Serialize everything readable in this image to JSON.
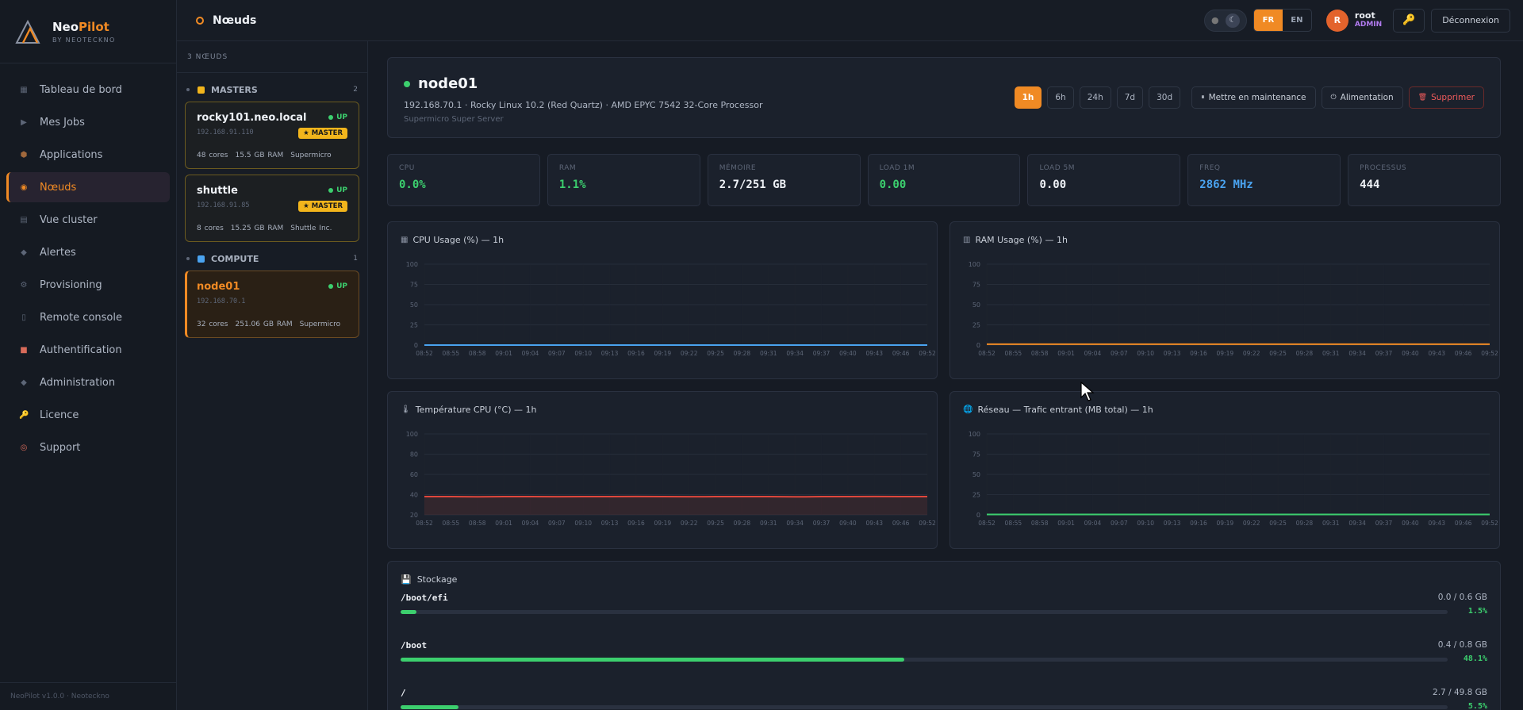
{
  "brand": {
    "name_a": "Neo",
    "name_b": "Pilot",
    "sub": "BY NEOTECKNO"
  },
  "sidebar": {
    "items": [
      {
        "label": "Tableau de bord",
        "icon": "grid-icon",
        "glyph": "▦"
      },
      {
        "label": "Mes Jobs",
        "icon": "play-icon",
        "glyph": "▶"
      },
      {
        "label": "Applications",
        "icon": "box-icon",
        "glyph": "⬢"
      },
      {
        "label": "Nœuds",
        "icon": "node-icon",
        "glyph": "◉"
      },
      {
        "label": "Vue cluster",
        "icon": "cluster-icon",
        "glyph": "▤"
      },
      {
        "label": "Alertes",
        "icon": "alert-icon",
        "glyph": "◆"
      },
      {
        "label": "Provisioning",
        "icon": "gear-icon",
        "glyph": "⚙"
      },
      {
        "label": "Remote console",
        "icon": "terminal-icon",
        "glyph": "▯"
      },
      {
        "label": "Authentification",
        "icon": "lock-icon",
        "glyph": "■"
      },
      {
        "label": "Administration",
        "icon": "admin-icon",
        "glyph": "◆"
      },
      {
        "label": "Licence",
        "icon": "key-icon",
        "glyph": "🔑"
      },
      {
        "label": "Support",
        "icon": "lifebuoy-icon",
        "glyph": "◎"
      }
    ],
    "footer": "NeoPilot v1.0.0 · Neoteckno"
  },
  "topbar": {
    "title": "Nœuds",
    "lang_fr": "FR",
    "lang_en": "EN",
    "user_initial": "R",
    "user_name": "root",
    "user_role": "ADMIN",
    "logout": "Déconnexion"
  },
  "nodelist": {
    "count": "3 NŒUDS",
    "groups": [
      {
        "name": "MASTERS",
        "count": "2",
        "color": "#f2b51c"
      },
      {
        "name": "COMPUTE",
        "count": "1",
        "color": "#4aa3f0"
      }
    ],
    "nodes": [
      {
        "name": "rocky101.neo.local",
        "ip": "192.168.91.110",
        "cores": "48 cores",
        "ram": "15.5 GB RAM",
        "vendor": "Supermicro",
        "status": "UP",
        "badge": "★ MASTER"
      },
      {
        "name": "shuttle",
        "ip": "192.168.91.85",
        "cores": "8 cores",
        "ram": "15.25 GB RAM",
        "vendor": "Shuttle Inc.",
        "status": "UP",
        "badge": "★ MASTER"
      },
      {
        "name": "node01",
        "ip": "192.168.70.1",
        "cores": "32 cores",
        "ram": "251.06 GB RAM",
        "vendor": "Supermicro",
        "status": "UP"
      }
    ]
  },
  "node": {
    "name": "node01",
    "info": "192.168.70.1 · Rocky Linux 10.2 (Red Quartz) · AMD EPYC 7542 32-Core Processor",
    "hardware": "Supermicro Super Server",
    "ranges": [
      "1h",
      "6h",
      "24h",
      "7d",
      "30d"
    ],
    "actions": {
      "maintenance": "Mettre en maintenance",
      "power": "Alimentation",
      "delete": "Supprimer"
    }
  },
  "stats": [
    {
      "label": "CPU",
      "value": "0.0%",
      "tone": "green"
    },
    {
      "label": "RAM",
      "value": "1.1%",
      "tone": "green"
    },
    {
      "label": "MÉMOIRE",
      "value": "2.7/251 GB",
      "tone": "white"
    },
    {
      "label": "LOAD 1M",
      "value": "0.00",
      "tone": "green"
    },
    {
      "label": "LOAD 5M",
      "value": "0.00",
      "tone": "white"
    },
    {
      "label": "FREQ",
      "value": "2862 MHz",
      "tone": "blue"
    },
    {
      "label": "PROCESSUS",
      "value": "444",
      "tone": "white"
    }
  ],
  "chart_data": [
    {
      "type": "line",
      "title": "CPU Usage (%) — 1h",
      "icon": "chip-icon",
      "color": "#4aa3f0",
      "ylim": [
        0,
        100
      ],
      "yticks": [
        0,
        25,
        50,
        75,
        100
      ],
      "x": [
        "08:52",
        "08:55",
        "08:58",
        "09:01",
        "09:04",
        "09:07",
        "09:10",
        "09:13",
        "09:16",
        "09:19",
        "09:22",
        "09:25",
        "09:28",
        "09:31",
        "09:34",
        "09:37",
        "09:40",
        "09:43",
        "09:46",
        "09:52"
      ],
      "values": [
        0,
        0,
        0,
        0,
        0,
        0,
        0,
        0,
        0,
        0,
        0,
        0,
        0,
        0,
        0,
        0,
        0,
        0,
        0,
        0
      ]
    },
    {
      "type": "line",
      "title": "RAM Usage (%) — 1h",
      "icon": "memory-icon",
      "color": "#f08a24",
      "ylim": [
        0,
        100
      ],
      "yticks": [
        0,
        25,
        50,
        75,
        100
      ],
      "x": [
        "08:52",
        "08:55",
        "08:58",
        "09:01",
        "09:04",
        "09:07",
        "09:10",
        "09:13",
        "09:16",
        "09:19",
        "09:22",
        "09:25",
        "09:28",
        "09:31",
        "09:34",
        "09:37",
        "09:40",
        "09:43",
        "09:46",
        "09:52"
      ],
      "values": [
        1.1,
        1.1,
        1.1,
        1.1,
        1.1,
        1.1,
        1.1,
        1.1,
        1.1,
        1.1,
        1.1,
        1.1,
        1.1,
        1.1,
        1.1,
        1.1,
        1.1,
        1.1,
        1.1,
        1.1
      ]
    },
    {
      "type": "area",
      "title": "Température CPU (°C) — 1h",
      "icon": "thermometer-icon",
      "color": "#e0473c",
      "ylim": [
        20,
        100
      ],
      "yticks": [
        20,
        40,
        60,
        80,
        100
      ],
      "x": [
        "08:52",
        "08:55",
        "08:58",
        "09:01",
        "09:04",
        "09:07",
        "09:10",
        "09:13",
        "09:16",
        "09:19",
        "09:22",
        "09:25",
        "09:28",
        "09:31",
        "09:34",
        "09:37",
        "09:40",
        "09:43",
        "09:46",
        "09:52"
      ],
      "values": [
        38,
        38,
        37.8,
        38,
        38,
        37.9,
        38,
        38,
        38.1,
        38,
        37.9,
        38,
        38,
        38,
        37.8,
        38,
        38,
        38.1,
        38,
        38
      ]
    },
    {
      "type": "line",
      "title": "Réseau — Trafic entrant (MB total) — 1h",
      "icon": "globe-icon",
      "color": "#3ccf6e",
      "ylim": [
        0,
        100
      ],
      "yticks": [
        0,
        25,
        50,
        75,
        100
      ],
      "x": [
        "08:52",
        "08:55",
        "08:58",
        "09:01",
        "09:04",
        "09:07",
        "09:10",
        "09:13",
        "09:16",
        "09:19",
        "09:22",
        "09:25",
        "09:28",
        "09:31",
        "09:34",
        "09:37",
        "09:40",
        "09:43",
        "09:46",
        "09:52"
      ],
      "values": [
        0.5,
        0.5,
        0.5,
        0.5,
        0.5,
        0.5,
        0.5,
        0.5,
        0.5,
        0.5,
        0.5,
        0.5,
        0.5,
        0.5,
        0.5,
        0.5,
        0.5,
        0.5,
        0.5,
        0.5
      ]
    }
  ],
  "storage": {
    "title": "Stockage",
    "disks": [
      {
        "mount": "/boot/efi",
        "used": "0.0 / 0.6 GB",
        "pct": "1.5%",
        "fraction": 0.015
      },
      {
        "mount": "/boot",
        "used": "0.4 / 0.8 GB",
        "pct": "48.1%",
        "fraction": 0.481
      },
      {
        "mount": "/",
        "used": "2.7 / 49.8 GB",
        "pct": "5.5%",
        "fraction": 0.055
      }
    ]
  }
}
